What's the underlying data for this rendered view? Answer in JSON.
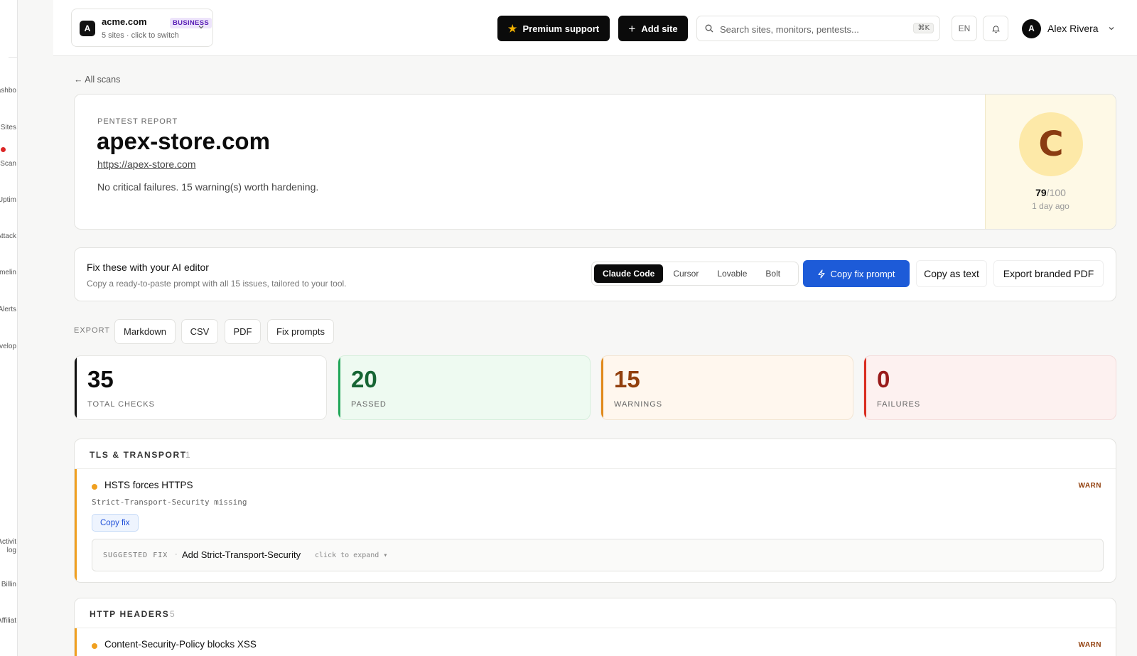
{
  "sidebar": {
    "items": [
      "ashbo",
      "Sites",
      "Scan",
      "Uptim",
      "Attack",
      "Timelin",
      "Alerts",
      "evelop",
      "Activit",
      "log",
      "Billin",
      "Affiliat"
    ]
  },
  "topbar": {
    "site_name": "acme.com",
    "site_plan": "BUSINESS",
    "site_sub": "5 sites · click to switch",
    "site_logo": "A",
    "premium_label": "Premium support",
    "add_site_label": "Add site",
    "search_placeholder": "Search sites, monitors, pentests...",
    "search_shortcut": "⌘K",
    "lang": "EN",
    "user_initial": "A",
    "user_name": "Alex Rivera"
  },
  "main": {
    "back_label": "All scans",
    "report": {
      "eyebrow": "PENTEST REPORT",
      "domain": "apex-store.com",
      "url": "https://apex-store.com",
      "summary": "No critical failures. 15 warning(s) worth hardening.",
      "grade": "C",
      "score": "79",
      "score_max": "/100",
      "time": "1 day ago"
    },
    "ai": {
      "title": "Fix these with your AI editor",
      "subtitle": "Copy a ready-to-paste prompt with all 15 issues, tailored to your tool.",
      "tools": [
        "Claude Code",
        "Cursor",
        "Lovable",
        "Bolt"
      ],
      "active_tool": "Claude Code",
      "copy_prompt_label": "Copy fix prompt",
      "copy_text_label": "Copy as text",
      "export_pdf_label": "Export branded PDF"
    },
    "export": {
      "label": "EXPORT",
      "options": [
        "Markdown",
        "CSV",
        "PDF",
        "Fix prompts"
      ]
    },
    "stats": {
      "total": {
        "value": "35",
        "label": "TOTAL CHECKS"
      },
      "passed": {
        "value": "20",
        "label": "PASSED"
      },
      "warnings": {
        "value": "15",
        "label": "WARNINGS"
      },
      "failures": {
        "value": "0",
        "label": "FAILURES"
      }
    },
    "sections": [
      {
        "title": "TLS & TRANSPORT",
        "count": "1",
        "issues": [
          {
            "title": "HSTS forces HTTPS",
            "status": "WARN",
            "detail": "Strict-Transport-Security missing",
            "copy_fix_label": "Copy fix",
            "fix_label": "SUGGESTED FIX",
            "fix_sep": "·",
            "fix_title": "Add Strict-Transport-Security",
            "fix_hint": "click to expand ▾"
          }
        ]
      },
      {
        "title": "HTTP HEADERS",
        "count": "5",
        "issues": [
          {
            "title": "Content-Security-Policy blocks XSS",
            "status": "WARN"
          }
        ]
      }
    ]
  },
  "colors": {
    "accent_blue": "#1d5bd8",
    "pass_green": "#22a65a",
    "warn_orange": "#e0891a",
    "fail_red": "#d92d20",
    "plan_purple": "#5b21b6"
  }
}
